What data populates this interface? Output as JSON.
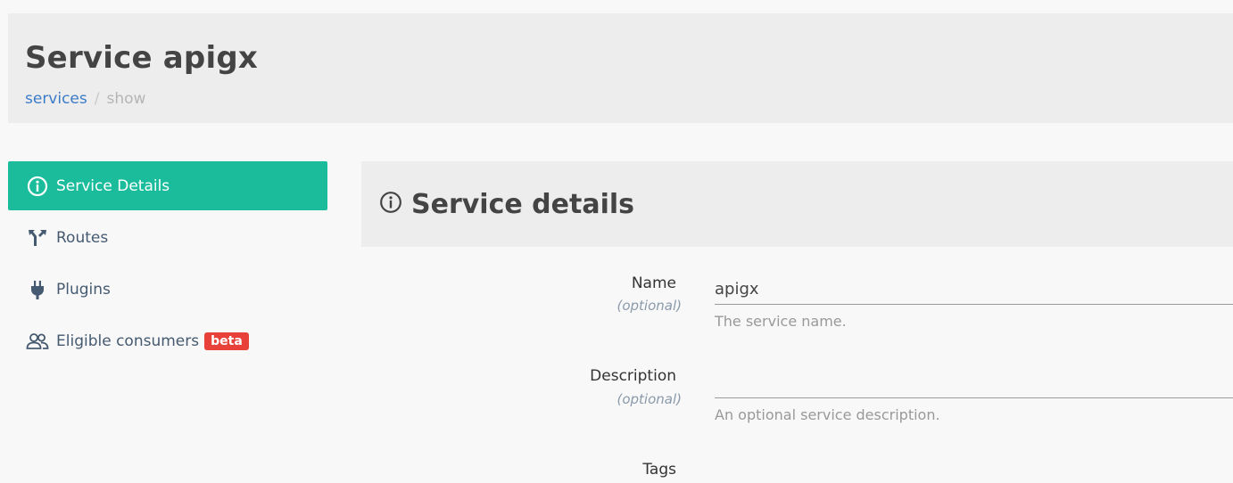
{
  "header": {
    "title": "Service apigx",
    "breadcrumb": {
      "link": "services",
      "separator": "/",
      "current": "show"
    }
  },
  "sidebar": {
    "items": [
      {
        "label": "Service Details",
        "icon": "info-circle-icon",
        "active": true
      },
      {
        "label": "Routes",
        "icon": "routes-icon",
        "active": false
      },
      {
        "label": "Plugins",
        "icon": "plug-icon",
        "active": false
      },
      {
        "label": "Eligible consumers",
        "icon": "users-icon",
        "active": false,
        "badge": "beta"
      }
    ]
  },
  "panel": {
    "title": "Service details",
    "fields": [
      {
        "label": "Name",
        "optional": "(optional)",
        "value": "apigx",
        "help": "The service name."
      },
      {
        "label": "Description",
        "optional": "(optional)",
        "value": "",
        "help": "An optional service description."
      },
      {
        "label": "Tags"
      }
    ]
  },
  "colors": {
    "accent": "#1abc9c",
    "badge": "#e8413a",
    "link": "#3a7bc8"
  }
}
